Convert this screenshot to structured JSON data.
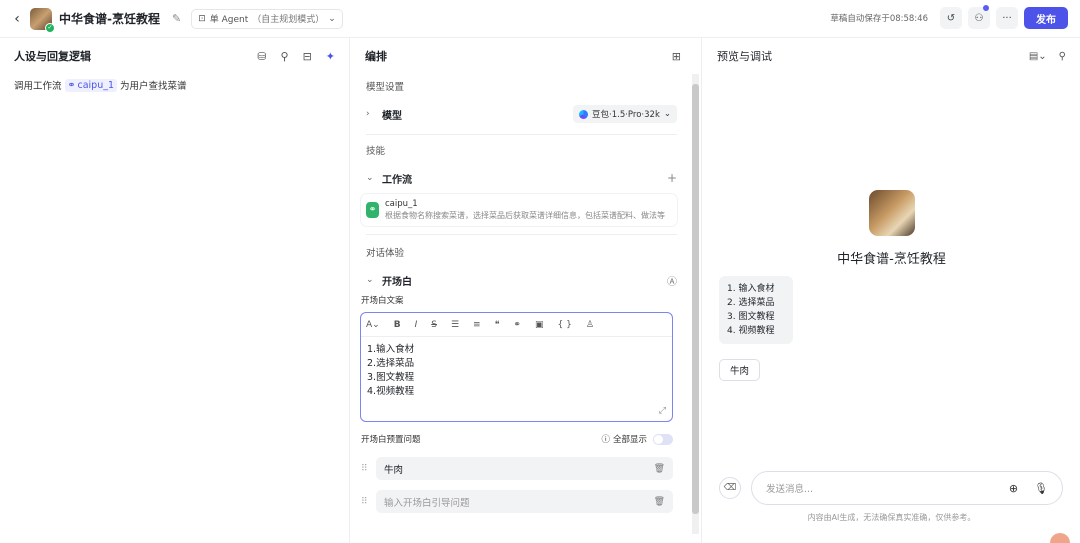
{
  "header": {
    "app_title": "中华食谱-烹饪教程",
    "agent_mode": "单 Agent",
    "agent_mode_sub": "（自主规划模式）",
    "autosave": "草稿自动保存于08:58:46",
    "publish_label": "发布"
  },
  "left": {
    "title": "人设与回复逻辑",
    "prompt_before": "调用工作流",
    "prompt_tag": "caipu_1",
    "prompt_after": "为用户查找菜谱"
  },
  "middle": {
    "title": "编排",
    "model_section": "模型设置",
    "model_label": "模型",
    "model_value": "豆包·1.5·Pro·32k",
    "skills_section": "技能",
    "workflow_label": "工作流",
    "workflow_name": "caipu_1",
    "workflow_desc": "根据食物名称搜索菜谱，选择菜品后获取菜谱详细信息，包括菜谱配料、做法等",
    "dialog_section": "对话体验",
    "opener_label": "开场白",
    "opener_text_label": "开场白文案",
    "editor_lines": [
      "1.输入食材",
      "2.选择菜品",
      "3.图文教程",
      "4.视频教程"
    ],
    "preset_q_label": "开场白预置问题",
    "show_all_label": "全部显示",
    "question_1": "牛肉",
    "question_placeholder": "输入开场白引导问题"
  },
  "right": {
    "title": "预览与调试",
    "bot_name": "中华食谱-烹饪教程",
    "bubble_lines": [
      "1. 输入食材",
      "2. 选择菜品",
      "3. 图文教程",
      "4. 视频教程"
    ],
    "suggestion": "牛肉",
    "input_placeholder": "发送消息...",
    "disclaimer": "内容由AI生成，无法确保真实准确，仅供参考。"
  },
  "colors": {
    "accent": "#4d53e8",
    "workflow_icon": "#32b36b"
  },
  "icons": {
    "back": "chevron-left-icon",
    "edit": "edit-icon",
    "history": "history-icon",
    "users": "users-icon",
    "more": "more-icon",
    "db": "database-icon",
    "bulb": "lightbulb-icon",
    "sparkle": "sparkle-icon"
  }
}
